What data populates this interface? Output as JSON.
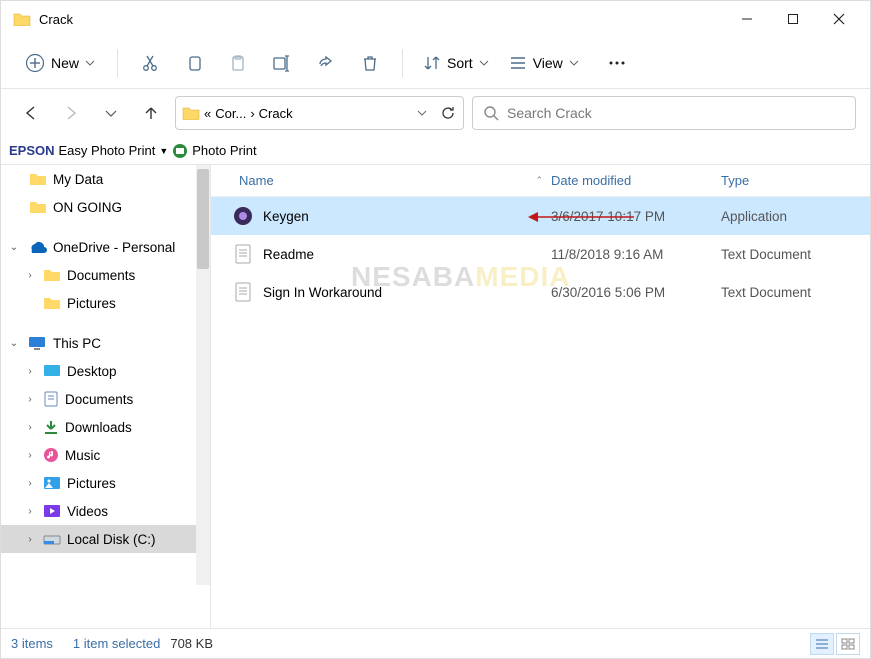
{
  "window": {
    "title": "Crack"
  },
  "toolbar": {
    "new": "New",
    "sort": "Sort",
    "view": "View"
  },
  "breadcrumb": {
    "ellipsis": "«",
    "seg1": "Cor...",
    "seg2": "Crack"
  },
  "search": {
    "placeholder": "Search Crack"
  },
  "epson": {
    "brand": "EPSON",
    "app": "Easy Photo Print",
    "photo": "Photo Print"
  },
  "tree": {
    "mydata": "My Data",
    "ongoing": "ON GOING",
    "onedrive": "OneDrive - Personal",
    "documents": "Documents",
    "pictures": "Pictures",
    "thispc": "This PC",
    "desktop": "Desktop",
    "documents2": "Documents",
    "downloads": "Downloads",
    "music": "Music",
    "pictures2": "Pictures",
    "videos": "Videos",
    "localdisk": "Local Disk (C:)"
  },
  "headers": {
    "name": "Name",
    "date": "Date modified",
    "type": "Type"
  },
  "files": [
    {
      "name": "Keygen",
      "date": "3/6/2017 10:17 PM",
      "type": "Application"
    },
    {
      "name": "Readme",
      "date": "11/8/2018 9:16 AM",
      "type": "Text Document"
    },
    {
      "name": "Sign In Workaround",
      "date": "6/30/2016 5:06 PM",
      "type": "Text Document"
    }
  ],
  "status": {
    "count": "3 items",
    "selected": "1 item selected",
    "size": "708 KB"
  },
  "watermark": {
    "a": "NESABA",
    "b": "MEDIA"
  }
}
